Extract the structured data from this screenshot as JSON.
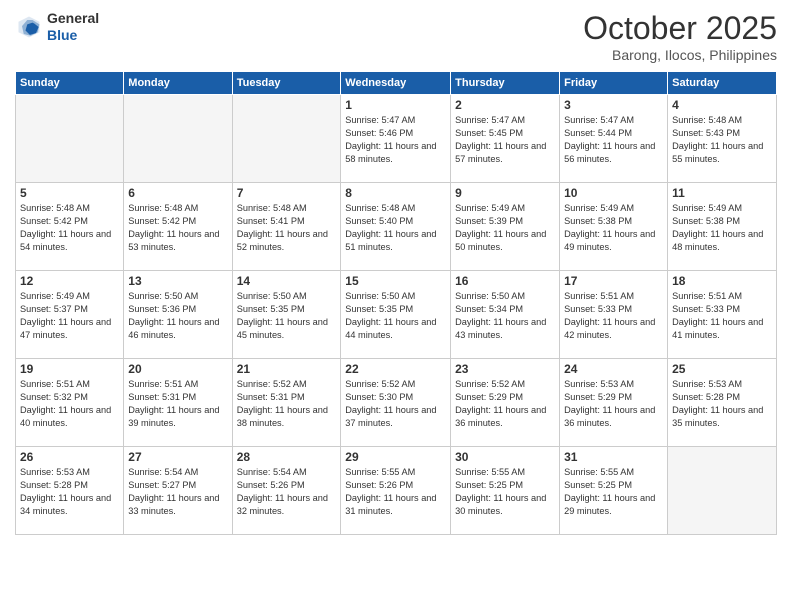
{
  "header": {
    "logo_line1": "General",
    "logo_line2": "Blue",
    "month": "October 2025",
    "location": "Barong, Ilocos, Philippines"
  },
  "days_of_week": [
    "Sunday",
    "Monday",
    "Tuesday",
    "Wednesday",
    "Thursday",
    "Friday",
    "Saturday"
  ],
  "weeks": [
    [
      {
        "day": "",
        "empty": true
      },
      {
        "day": "",
        "empty": true
      },
      {
        "day": "",
        "empty": true
      },
      {
        "day": "1",
        "sunrise": "5:47 AM",
        "sunset": "5:46 PM",
        "daylight": "11 hours and 58 minutes."
      },
      {
        "day": "2",
        "sunrise": "5:47 AM",
        "sunset": "5:45 PM",
        "daylight": "11 hours and 57 minutes."
      },
      {
        "day": "3",
        "sunrise": "5:47 AM",
        "sunset": "5:44 PM",
        "daylight": "11 hours and 56 minutes."
      },
      {
        "day": "4",
        "sunrise": "5:48 AM",
        "sunset": "5:43 PM",
        "daylight": "11 hours and 55 minutes."
      }
    ],
    [
      {
        "day": "5",
        "sunrise": "5:48 AM",
        "sunset": "5:42 PM",
        "daylight": "11 hours and 54 minutes."
      },
      {
        "day": "6",
        "sunrise": "5:48 AM",
        "sunset": "5:42 PM",
        "daylight": "11 hours and 53 minutes."
      },
      {
        "day": "7",
        "sunrise": "5:48 AM",
        "sunset": "5:41 PM",
        "daylight": "11 hours and 52 minutes."
      },
      {
        "day": "8",
        "sunrise": "5:48 AM",
        "sunset": "5:40 PM",
        "daylight": "11 hours and 51 minutes."
      },
      {
        "day": "9",
        "sunrise": "5:49 AM",
        "sunset": "5:39 PM",
        "daylight": "11 hours and 50 minutes."
      },
      {
        "day": "10",
        "sunrise": "5:49 AM",
        "sunset": "5:38 PM",
        "daylight": "11 hours and 49 minutes."
      },
      {
        "day": "11",
        "sunrise": "5:49 AM",
        "sunset": "5:38 PM",
        "daylight": "11 hours and 48 minutes."
      }
    ],
    [
      {
        "day": "12",
        "sunrise": "5:49 AM",
        "sunset": "5:37 PM",
        "daylight": "11 hours and 47 minutes."
      },
      {
        "day": "13",
        "sunrise": "5:50 AM",
        "sunset": "5:36 PM",
        "daylight": "11 hours and 46 minutes."
      },
      {
        "day": "14",
        "sunrise": "5:50 AM",
        "sunset": "5:35 PM",
        "daylight": "11 hours and 45 minutes."
      },
      {
        "day": "15",
        "sunrise": "5:50 AM",
        "sunset": "5:35 PM",
        "daylight": "11 hours and 44 minutes."
      },
      {
        "day": "16",
        "sunrise": "5:50 AM",
        "sunset": "5:34 PM",
        "daylight": "11 hours and 43 minutes."
      },
      {
        "day": "17",
        "sunrise": "5:51 AM",
        "sunset": "5:33 PM",
        "daylight": "11 hours and 42 minutes."
      },
      {
        "day": "18",
        "sunrise": "5:51 AM",
        "sunset": "5:33 PM",
        "daylight": "11 hours and 41 minutes."
      }
    ],
    [
      {
        "day": "19",
        "sunrise": "5:51 AM",
        "sunset": "5:32 PM",
        "daylight": "11 hours and 40 minutes."
      },
      {
        "day": "20",
        "sunrise": "5:51 AM",
        "sunset": "5:31 PM",
        "daylight": "11 hours and 39 minutes."
      },
      {
        "day": "21",
        "sunrise": "5:52 AM",
        "sunset": "5:31 PM",
        "daylight": "11 hours and 38 minutes."
      },
      {
        "day": "22",
        "sunrise": "5:52 AM",
        "sunset": "5:30 PM",
        "daylight": "11 hours and 37 minutes."
      },
      {
        "day": "23",
        "sunrise": "5:52 AM",
        "sunset": "5:29 PM",
        "daylight": "11 hours and 36 minutes."
      },
      {
        "day": "24",
        "sunrise": "5:53 AM",
        "sunset": "5:29 PM",
        "daylight": "11 hours and 36 minutes."
      },
      {
        "day": "25",
        "sunrise": "5:53 AM",
        "sunset": "5:28 PM",
        "daylight": "11 hours and 35 minutes."
      }
    ],
    [
      {
        "day": "26",
        "sunrise": "5:53 AM",
        "sunset": "5:28 PM",
        "daylight": "11 hours and 34 minutes."
      },
      {
        "day": "27",
        "sunrise": "5:54 AM",
        "sunset": "5:27 PM",
        "daylight": "11 hours and 33 minutes."
      },
      {
        "day": "28",
        "sunrise": "5:54 AM",
        "sunset": "5:26 PM",
        "daylight": "11 hours and 32 minutes."
      },
      {
        "day": "29",
        "sunrise": "5:55 AM",
        "sunset": "5:26 PM",
        "daylight": "11 hours and 31 minutes."
      },
      {
        "day": "30",
        "sunrise": "5:55 AM",
        "sunset": "5:25 PM",
        "daylight": "11 hours and 30 minutes."
      },
      {
        "day": "31",
        "sunrise": "5:55 AM",
        "sunset": "5:25 PM",
        "daylight": "11 hours and 29 minutes."
      },
      {
        "day": "",
        "empty": true
      }
    ]
  ],
  "labels": {
    "sunrise_prefix": "Sunrise: ",
    "sunset_prefix": "Sunset: ",
    "daylight_prefix": "Daylight: "
  }
}
